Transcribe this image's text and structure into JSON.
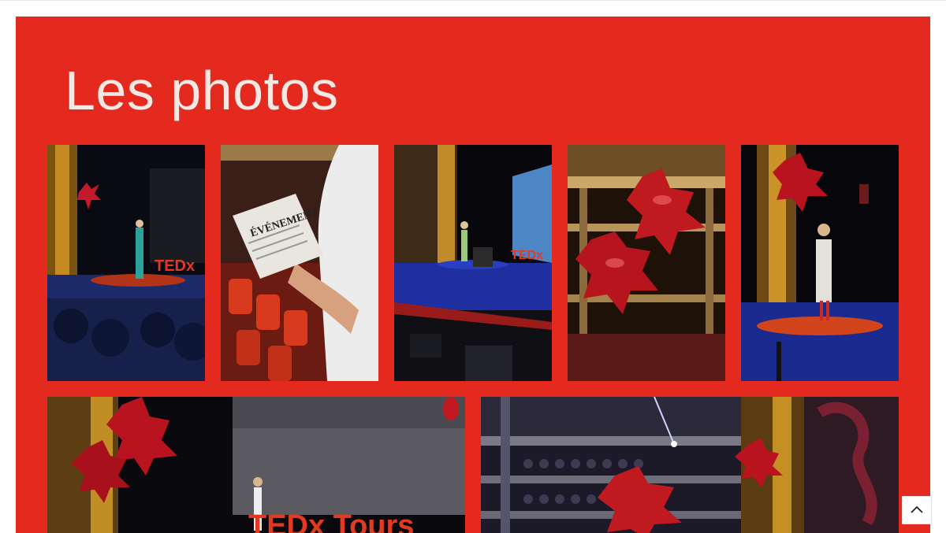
{
  "section": {
    "title": "Les photos",
    "background_color": "#e42a1e"
  },
  "photos": [
    {
      "description": "Speaker in teal dress on TEDx stage, audience in foreground",
      "stage_text": "TEDx"
    },
    {
      "description": "Person reading a newspaper in a theatre with red seats",
      "newspaper_text": "ÉVÉNEMENT"
    },
    {
      "description": "Speaker at lectern on stage with projection screen",
      "stage_text": "TEDx"
    },
    {
      "description": "Red X-shaped balloons inside ornate theatre balconies"
    },
    {
      "description": "Speaker in patterned dress on red circular carpet"
    },
    {
      "description": "Wide shot of speaker on stage in front of TEDx Tours logo",
      "stage_text": "TEDx Tours"
    },
    {
      "description": "Theatre balconies with audience and red balloons"
    }
  ],
  "back_to_top": {
    "icon": "chevron-up-icon"
  }
}
